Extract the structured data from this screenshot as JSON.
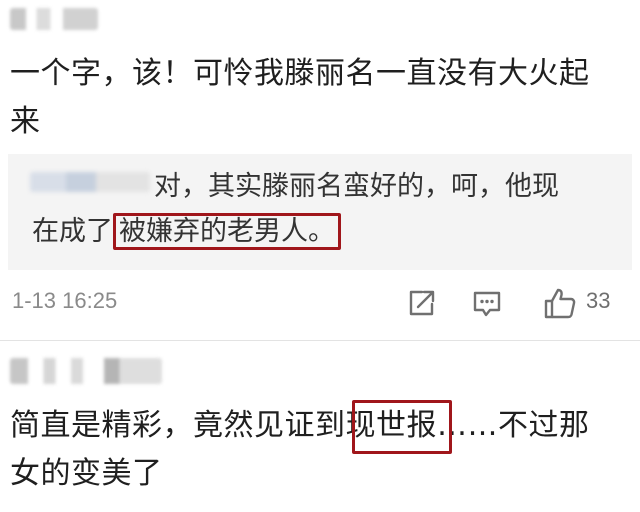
{
  "comments": [
    {
      "text_line1": "一个字，该！可怜我滕丽名一直没有大火起",
      "text_line2": "来",
      "reply": {
        "text_before": "对，其实滕丽名蛮好的，呵，他现",
        "text_line2_prefix": "在成了",
        "text_highlight": "被嫌弃的老男人。"
      },
      "meta": {
        "timestamp": "1-13 16:25",
        "like_count": "33"
      }
    },
    {
      "text_line1_a": "简直是精彩，竟然见证到",
      "text_highlight": "现世报",
      "text_line1_b": "……不过那",
      "text_line2": "女的变美了"
    }
  ],
  "icons": {
    "share": "share-icon",
    "comment": "comment-icon",
    "like": "thumbs-up-icon"
  },
  "colors": {
    "highlight_border": "#a0161b",
    "reply_background": "#f4f4f4"
  }
}
